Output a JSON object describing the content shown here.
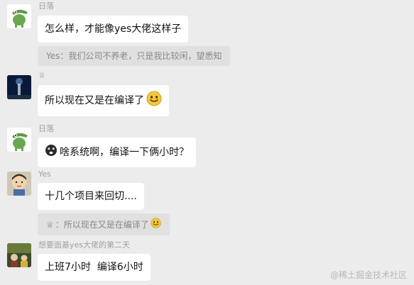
{
  "messages": [
    {
      "sender": "日落",
      "text": "怎么样，才能像yes大佬这样子",
      "quote": "Yes：我们公司不养老，只是我比较闲，望悉知"
    },
    {
      "sender": "♕",
      "text": "所以现在又是在编译了"
    },
    {
      "sender": "日落",
      "text": "啥系统啊，编译一下俩小时？"
    },
    {
      "sender": "Yes",
      "text": "十几个项目来回切....",
      "quote_icon": "♕",
      "quote": "：所以现在又是在编译了"
    },
    {
      "sender": "想要面基yes大佬的第二天",
      "text": "上班7小时  编译6小时"
    }
  ],
  "watermark": "@稀土掘金技术社区",
  "icons": {
    "smile": "smiling-face-icon",
    "sad": "dizzy-face-icon"
  },
  "colors": {
    "background": "#ececec",
    "bubble": "#ffffff",
    "quote_bg": "#e0e0e0",
    "name": "#a0a0a0"
  }
}
